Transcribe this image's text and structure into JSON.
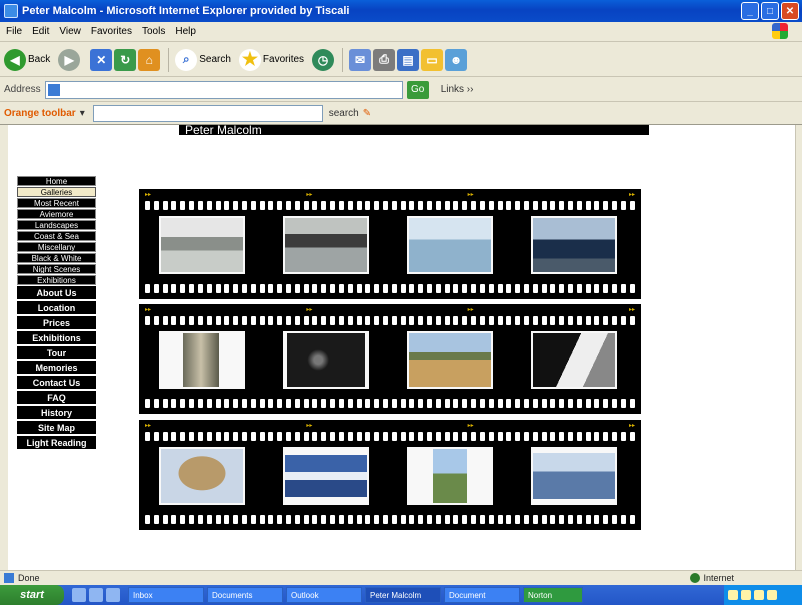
{
  "window": {
    "title": "Peter Malcolm - Microsoft Internet Explorer provided by Tiscali"
  },
  "menubar": {
    "items": [
      "File",
      "Edit",
      "View",
      "Favorites",
      "Tools",
      "Help"
    ]
  },
  "toolbar": {
    "back": "Back",
    "search": "Search",
    "favorites": "Favorites"
  },
  "addressbar": {
    "label": "Address",
    "go": "Go",
    "extra": "Links ››"
  },
  "orangebar": {
    "label": "Orange toolbar",
    "search": "search"
  },
  "page": {
    "header": "Peter Malcolm",
    "nav": [
      {
        "label": "Home",
        "type": "small"
      },
      {
        "label": "Galleries",
        "type": "active"
      },
      {
        "label": "Most Recent",
        "type": "small"
      },
      {
        "label": "Aviemore",
        "type": "small"
      },
      {
        "label": "Landscapes",
        "type": "small"
      },
      {
        "label": "Coast & Sea",
        "type": "small"
      },
      {
        "label": "Miscellany",
        "type": "small"
      },
      {
        "label": "Black & White",
        "type": "small"
      },
      {
        "label": "Night Scenes",
        "type": "small"
      },
      {
        "label": "Exhibitions",
        "type": "small"
      },
      {
        "label": "About Us",
        "type": "big"
      },
      {
        "label": "Location",
        "type": "big"
      },
      {
        "label": "Prices",
        "type": "big"
      },
      {
        "label": "Exhibitions",
        "type": "big"
      },
      {
        "label": "Tour",
        "type": "big"
      },
      {
        "label": "Memories",
        "type": "big"
      },
      {
        "label": "Contact Us",
        "type": "big"
      },
      {
        "label": "FAQ",
        "type": "big"
      },
      {
        "label": "History",
        "type": "big"
      },
      {
        "label": "Site Map",
        "type": "big"
      },
      {
        "label": "Light Reading",
        "type": "big"
      }
    ]
  },
  "status": {
    "text": "Done",
    "zone": "Internet"
  },
  "taskbar": {
    "start": "start",
    "tasks": [
      "Inbox",
      "Documents",
      "Outlook",
      "Peter Malcolm",
      "Document",
      "Norton"
    ]
  }
}
